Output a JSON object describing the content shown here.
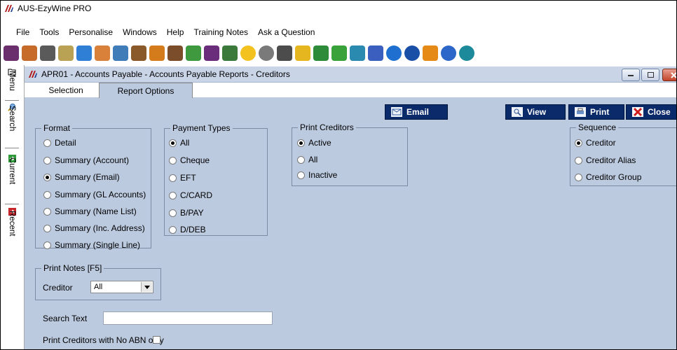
{
  "app": {
    "title": "AUS-EzyWine PRO"
  },
  "menu": [
    "File",
    "Tools",
    "Personalise",
    "Windows",
    "Help",
    "Training Notes",
    "Ask a Question"
  ],
  "toolbar_icons": [
    "wine-glass-icon",
    "brush-icon",
    "printer-icon",
    "tag-icon",
    "window-icon",
    "people-icon",
    "pen-icon",
    "barrel-icon",
    "fork-icon",
    "cocktail-icon",
    "boat-icon",
    "grapes-icon",
    "bug-icon",
    "star-icon",
    "gear-icon",
    "stop-icon",
    "box-icon",
    "plant-icon",
    "dollar-icon",
    "gift-icon",
    "facebook-icon",
    "info-circle-icon",
    "info-icon",
    "sock-icon",
    "question-icon",
    "globe-icon"
  ],
  "sidebar": [
    {
      "icon": "folder-icon",
      "label": "Menu"
    },
    {
      "icon": "search-icon",
      "label": "Search"
    },
    {
      "icon": "current-icon",
      "label": "Current"
    },
    {
      "icon": "recent-icon",
      "label": "Recent"
    }
  ],
  "window": {
    "title": "APR01 - Accounts Payable - Accounts Payable Reports - Creditors",
    "tabs": [
      "Selection",
      "Report Options"
    ],
    "active_tab": "Report Options"
  },
  "buttons": {
    "email": "Email",
    "view": "View",
    "print": "Print",
    "close": "Close"
  },
  "format": {
    "title": "Format",
    "options": [
      "Detail",
      "Summary (Account)",
      "Summary (Email)",
      "Summary (GL Accounts)",
      "Summary (Name List)",
      "Summary (Inc. Address)",
      "Summary (Single Line)"
    ],
    "selected": "Summary (Email)"
  },
  "payment_types": {
    "title": "Payment Types",
    "options": [
      "All",
      "Cheque",
      "EFT",
      "C/CARD",
      "B/PAY",
      "D/DEB"
    ],
    "selected": "All"
  },
  "print_creditors": {
    "title": "Print Creditors",
    "options": [
      "Active",
      "All",
      "Inactive"
    ],
    "selected": "Active"
  },
  "sequence": {
    "title": "Sequence",
    "options": [
      "Creditor",
      "Creditor Alias",
      "Creditor Group"
    ],
    "selected": "Creditor"
  },
  "print_notes": {
    "title": "Print Notes [F5]",
    "field_label": "Creditor",
    "value": "All"
  },
  "search_text": {
    "label": "Search Text",
    "value": ""
  },
  "no_abn": {
    "label": "Print Creditors with No ABN only",
    "checked": false
  },
  "colors": {
    "panel": "#bccae0",
    "button": "#0a2a6a"
  }
}
